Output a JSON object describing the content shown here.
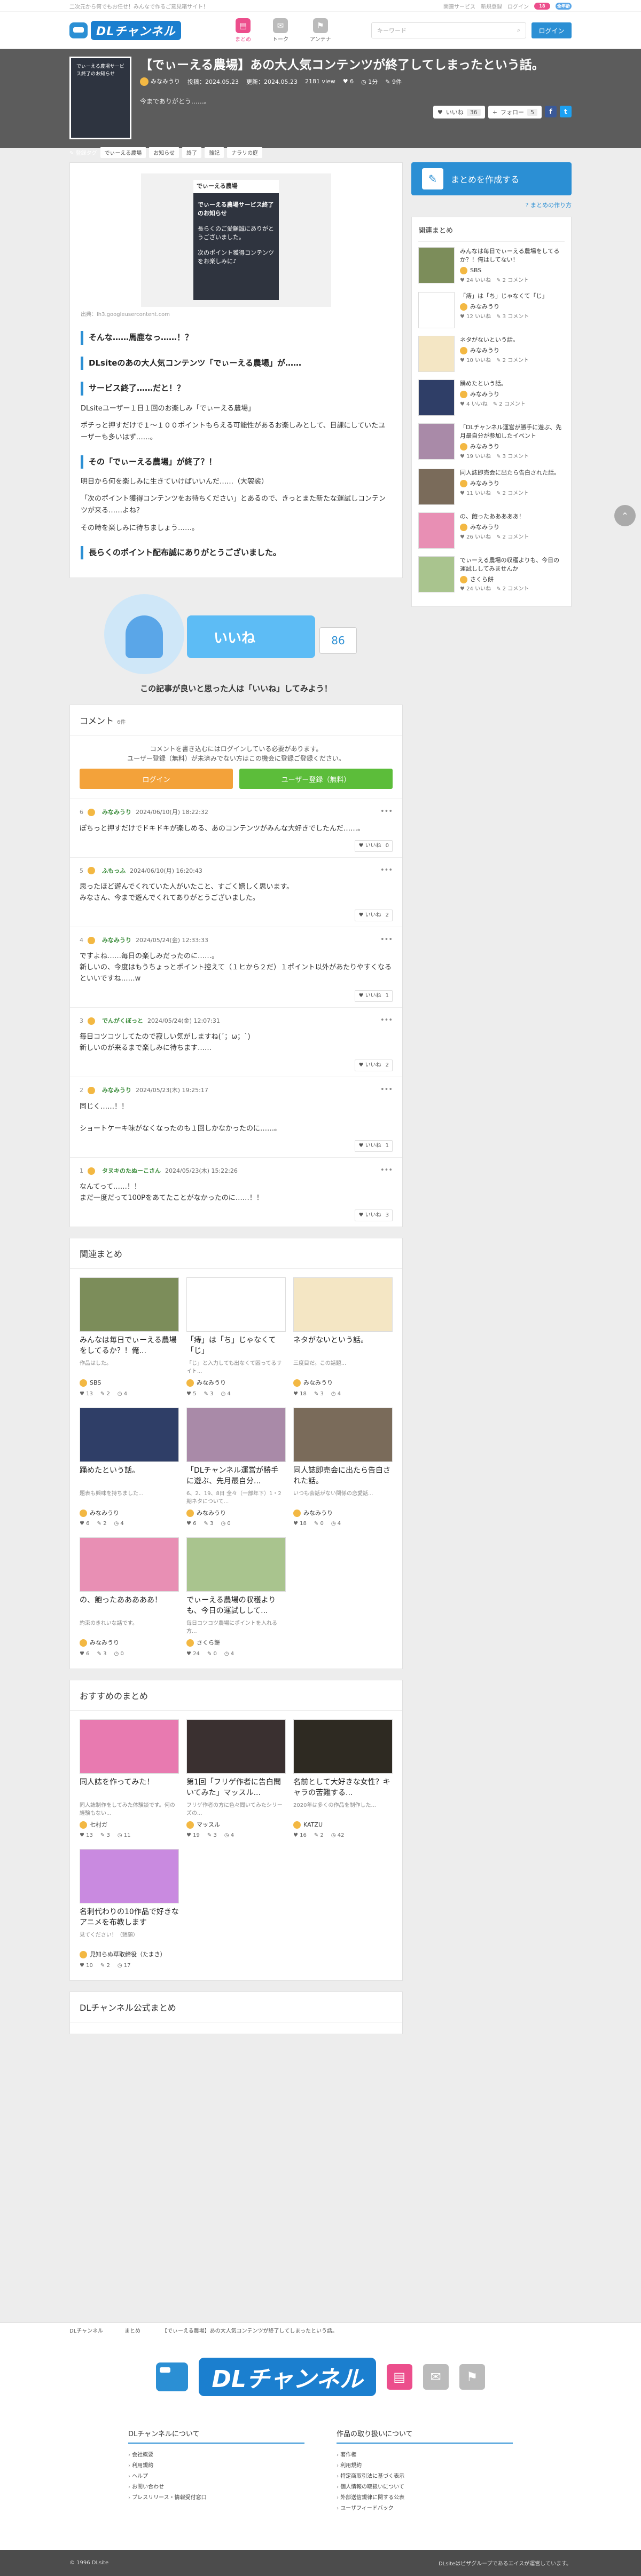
{
  "topbar": {
    "tagline": "二次元から何でもお任せ！みんなで作るご意見箱サイト！",
    "links": [
      "関連サービス",
      "新規登録",
      "ログイン"
    ],
    "badges": [
      "18",
      "全年齢"
    ]
  },
  "header": {
    "logo": "DLチャンネル",
    "navs": [
      {
        "label": "まとめ",
        "icon": "book-icon"
      },
      {
        "label": "トーク",
        "icon": "chat-icon"
      },
      {
        "label": "アンテナ",
        "icon": "antenna-icon"
      }
    ],
    "search_placeholder": "キーワード",
    "login": "ログイン"
  },
  "hero": {
    "thumb_text": "でぃーえる農場サービス終了のお知らせ",
    "title": "【でぃーえる農場】あの大人気コンテンツが終了してしまったという話。",
    "author": "みなみうり",
    "posted": "投稿：2024.05.23",
    "updated": "更新：2024.05.23",
    "views": "2181 view",
    "counts": [
      "6",
      "1分",
      "9件"
    ],
    "desc": "今までありがとう……。",
    "like_label": "いいね",
    "like_count": "36",
    "follow_label": "フォロー",
    "follow_count": "5",
    "tags_label": "登録タグ",
    "tags": [
      "でぃーえる農場",
      "お知らせ",
      "終了",
      "雑記",
      "ナラリの庭"
    ]
  },
  "article": {
    "image_header": "でぃーえる農場",
    "image_lines": [
      "でぃーえる農場サービス終了のお知らせ",
      "長らくのご愛顧誠にありがとうございました。",
      "次のポイント獲得コンテンツをお楽しみに♪"
    ],
    "caption": "出典：lh3.googleusercontent.com",
    "blocks": [
      {
        "type": "h",
        "text": "そんな……馬鹿なっ……！？"
      },
      {
        "type": "h",
        "text": "DLsiteのあの大人気コンテンツ「でぃーえる農場」が……"
      },
      {
        "type": "h",
        "text": "サービス終了……だと！？"
      },
      {
        "type": "p",
        "text": "DLsiteユーザー１日１回のお楽しみ「でぃーえる農場」"
      },
      {
        "type": "p",
        "text": "ポチっと押すだけで１～１００ポイントもらえる可能性があるお楽しみとして、日課にしていたユーザーも多いはず……。"
      },
      {
        "type": "h",
        "text": "その「でぃーえる農場」が終了？！"
      },
      {
        "type": "p",
        "text": "明日から何を楽しみに生きていけばいいんだ……（大袈裟）"
      },
      {
        "type": "p",
        "text": "「次のポイント獲得コンテンツをお待ちください」とあるので、きっとまた新たな運試しコンテンツが来る……よね？"
      },
      {
        "type": "p",
        "text": "その時を楽しみに待ちましょう……。"
      },
      {
        "type": "h",
        "text": "長らくのポイント配布誠にありがとうございました。"
      }
    ],
    "iine_label": "いいね",
    "iine_count": "86",
    "iine_msg": "この記事が良いと思った人は「いいね」してみよう！"
  },
  "comments": {
    "title": "コメント",
    "count": "6件",
    "login_msg": [
      "コメントを書き込むにはログインしている必要があります。",
      "ユーザー登録（無料）が未済みでない方はこの機会に登録ご登録ください。"
    ],
    "login_btn": "ログイン",
    "register_btn": "ユーザー登録（無料）",
    "items": [
      {
        "num": "6",
        "name": "みなみうり",
        "date": "2024/06/10(月) 18:22:32",
        "body": "ぽちっと押すだけでドキドキが楽しめる、あのコンテンツがみんな大好きでしたんだ……。",
        "likes": "0"
      },
      {
        "num": "5",
        "name": "ふもっふ",
        "date": "2024/06/10(月) 16:20:43",
        "body": "思ったほど遊んでくれていた人がいたこと、すごく嬉しく思います。\nみなさん、今まで遊んでくれてありがとうございました。",
        "likes": "2"
      },
      {
        "num": "4",
        "name": "みなみうり",
        "date": "2024/05/24(金) 12:33:33",
        "body": "ですよね……毎日の楽しみだったのに……。\n新しいの、今度はもうちょっとポイント控えて（１ヒから２だ）１ポイント以外があたりやすくなるといいですね……w",
        "likes": "1"
      },
      {
        "num": "3",
        "name": "でんがくぼっと",
        "date": "2024/05/24(金) 12:07:31",
        "body": "毎日コツコツしてたので寂しい気がしますね(´；ω；`)\n新しいのが来るまで楽しみに待ちます……",
        "likes": "2"
      },
      {
        "num": "2",
        "name": "みなみうり",
        "date": "2024/05/23(木) 19:25:17",
        "body": "同じく……！！\n\nショートケーキ味がなくなったのも１回しかなかったのに……。",
        "likes": "1"
      },
      {
        "num": "1",
        "name": "タヌキのたぬーこさん",
        "date": "2024/05/23(木) 15:22:26",
        "body": "なんてって……！！\nまだ一度だって100Pをあてたことがなかったのに……！！",
        "likes": "3"
      }
    ]
  },
  "related": {
    "title": "関連まとめ",
    "cards": [
      {
        "title": "みんなは毎日でぃーえる農場をしてるか？！俺...",
        "desc": "作品はした。",
        "user": "SBS",
        "stats": [
          "13",
          "2",
          "4"
        ],
        "color": "#7c8d5a"
      },
      {
        "title": "「痔」は「ち」じゃなくて「じ」",
        "desc": "「じ」と入力しても出なくて困ってるサイト...",
        "user": "みなみうり",
        "stats": [
          "5",
          "3",
          "4"
        ],
        "color": "#ffffff"
      },
      {
        "title": "ネタがないという話。",
        "desc": "三度目だ。この話題...",
        "user": "みなみうり",
        "stats": [
          "18",
          "3",
          "4"
        ],
        "color": "#f4e6c4"
      },
      {
        "title": "踊めたという話。",
        "desc": "題表も興味を持ちました...",
        "user": "みなみうり",
        "stats": [
          "6",
          "2",
          "4"
        ],
        "color": "#2f3e67"
      },
      {
        "title": "「DLチャンネル運営が勝手に遊ぶ、先月最自分...",
        "desc": "6、2、19、8日 全々（一部年下）1・2期ネタについて...",
        "user": "みなみうり",
        "stats": [
          "6",
          "3",
          "0"
        ],
        "color": "#a98aa8"
      },
      {
        "title": "同人誌即売会に出たら告白された話。",
        "desc": "いつも会話がない関係の恋愛話...",
        "user": "みなみうり",
        "stats": [
          "18",
          "0",
          "4"
        ],
        "color": "#7a6b5a"
      },
      {
        "title": "の、飽ったあああああ！",
        "desc": "約束のきれいな話です。",
        "user": "みなみうり",
        "stats": [
          "6",
          "3",
          "0"
        ],
        "color": "#e88fb4"
      },
      {
        "title": "でぃーえる農場の収穫よりも、今日の運試しして...",
        "desc": "毎日コツコツ農場にポイントを入れる方...",
        "user": "さくら餅",
        "stats": [
          "24",
          "0",
          "4"
        ],
        "color": "#a9c48e"
      }
    ]
  },
  "recommended": {
    "title": "おすすめのまとめ",
    "cards": [
      {
        "title": "同人誌を作ってみた！",
        "desc": "同人誌制作をしてみた体験談です。何の経験もない...",
        "user": "七村ガ",
        "stats": [
          "13",
          "3",
          "11"
        ],
        "color": "#e87ab0"
      },
      {
        "title": "第1回「フリゲ作者に告白聞いてみた」マッスル...",
        "desc": "フリゲ作者の方に色々聞いてみたシリーズの...",
        "user": "マッスル",
        "stats": [
          "19",
          "3",
          "4"
        ],
        "color": "#3a3030"
      },
      {
        "title": "名前として大好きな女性？キャラの苦難する...",
        "desc": "2020年は多くの作品を制作した...",
        "user": "KATZU",
        "stats": [
          "16",
          "2",
          "42"
        ],
        "color": "#2e2a22"
      },
      {
        "title": "名刺代わりの10作品で好きなアニメを布教します",
        "desc": "見てください！（懇願）",
        "user": "見知らぬ草取締役（たまき）",
        "stats": [
          "10",
          "2",
          "17"
        ],
        "color": "#c98ae0"
      }
    ]
  },
  "official": {
    "title": "DLチャンネル公式まとめ"
  },
  "sidebar": {
    "create_label": "まとめを作成する",
    "howto": "まとめの作り方",
    "related_title": "関連まとめ",
    "items": [
      {
        "title": "みんなは毎日でぃーえる農場をしてるか？！俺はしてない！",
        "user": "SBS",
        "likes": "24",
        "comments": "2",
        "color": "#7c8d5a"
      },
      {
        "title": "「痔」は「ち」じゃなくて「じ」",
        "user": "みなみうり",
        "likes": "12",
        "comments": "3",
        "color": "#ffffff"
      },
      {
        "title": "ネタがないという話。",
        "user": "みなみうり",
        "likes": "10",
        "comments": "2",
        "color": "#f4e6c4"
      },
      {
        "title": "踊めたという話。",
        "user": "みなみうり",
        "likes": "4",
        "comments": "2",
        "color": "#2f3e67"
      },
      {
        "title": "「DLチャンネル運営が勝手に遊ぶ、先月最自分が参加したイベント",
        "user": "みなみうり",
        "likes": "19",
        "comments": "3",
        "color": "#a98aa8"
      },
      {
        "title": "同人誌即売会に出たら告白された話。",
        "user": "みなみうり",
        "likes": "11",
        "comments": "2",
        "color": "#7a6b5a"
      },
      {
        "title": "の、飽ったあああああ！",
        "user": "みなみうり",
        "likes": "26",
        "comments": "2",
        "color": "#e88fb4"
      },
      {
        "title": "でぃーえる農場の収穫よりも、今日の運試ししてみませんか",
        "user": "さくら餅",
        "likes": "24",
        "comments": "2",
        "color": "#a9c48e"
      }
    ]
  },
  "breadcrumb": [
    "DLチャンネル",
    "まとめ",
    "【でぃーえる農場】あの大人気コンテンツが終了してしまったという話。"
  ],
  "footer": {
    "logo": "DLチャンネル",
    "col1_title": "DLチャンネルについて",
    "col1": [
      "会社概要",
      "利用規約",
      "ヘルプ",
      "お問い合わせ",
      "プレスリリース・情報受付窓口"
    ],
    "col2_title": "作品の取り扱いについて",
    "col2": [
      "著作権",
      "利用規約",
      "特定商取引法に基づく表示",
      "個人情報の取扱いについて",
      "外部送信規律に関する公表",
      "ユーザフィードバック"
    ],
    "copyright": "© 1996 DLsite",
    "group": "DLsiteはビザグループであるエイスが運営しています。"
  },
  "colors": {
    "accent": "#2b8fd4",
    "pink": "#ec4e8c",
    "orange": "#f3a23a",
    "green": "#5cbd3a"
  }
}
